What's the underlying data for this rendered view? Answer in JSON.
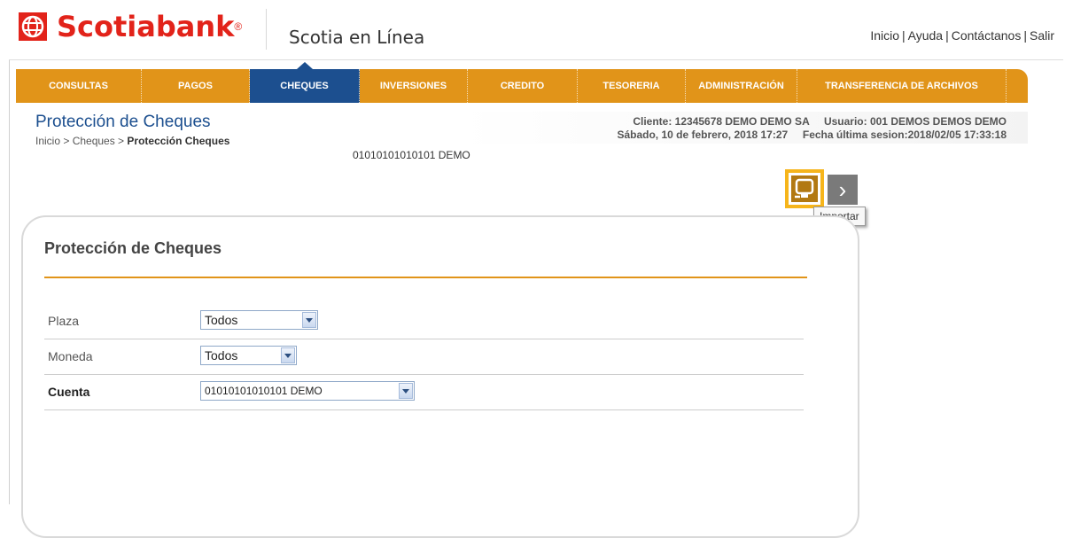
{
  "header": {
    "brand": "Scotiabank",
    "registered": "®",
    "app_name": "Scotia en Línea",
    "links": [
      "Inicio",
      "Ayuda",
      "Contáctanos",
      "Salir"
    ]
  },
  "nav": {
    "items": [
      {
        "label": "CONSULTAS"
      },
      {
        "label": "PAGOS"
      },
      {
        "label": "CHEQUES"
      },
      {
        "label": "INVERSIONES"
      },
      {
        "label": "CREDITO"
      },
      {
        "label": "TESORERIA"
      },
      {
        "label": "ADMINISTRACIÓN"
      },
      {
        "label": "TRANSFERENCIA DE ARCHIVOS"
      }
    ],
    "active": "CHEQUES"
  },
  "page": {
    "title": "Protección de Cheques",
    "breadcrumb_prefix": "Inicio > Cheques > ",
    "breadcrumb_current": "Protección Cheques",
    "account_label": "01010101010101 DEMO"
  },
  "info": {
    "client_line": "Cliente: 12345678 DEMO DEMO SA     Usuario: 001 DEMOS DEMOS DEMO",
    "date_line": "Sábado, 10 de febrero, 2018 17:27     Fecha última sesion:2018/02/05 17:33:18"
  },
  "actions": {
    "import_tooltip": "Importar",
    "next_symbol": "›"
  },
  "panel": {
    "title": "Protección de Cheques",
    "fields": {
      "plaza": {
        "label": "Plaza",
        "value": "Todos"
      },
      "moneda": {
        "label": "Moneda",
        "value": "Todos"
      },
      "cuenta": {
        "label": "Cuenta",
        "value": "01010101010101 DEMO"
      }
    }
  },
  "colors": {
    "brand_red": "#e2231a",
    "nav_orange": "#e19419",
    "nav_active": "#1c4f8f",
    "highlight": "#f6b51b"
  }
}
